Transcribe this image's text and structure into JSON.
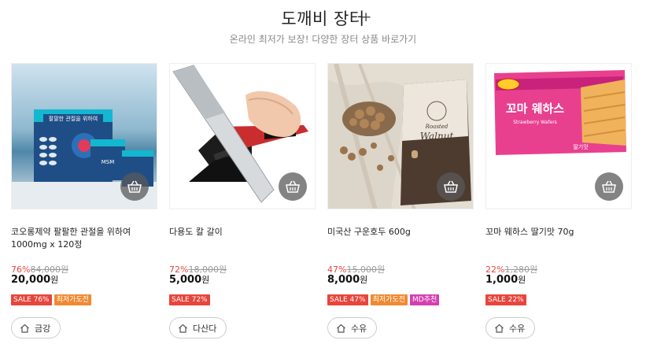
{
  "header": {
    "title": "도깨비 장터",
    "plus": "+",
    "subtitle": "온라인 최저가 보장! 다양한 장터 상품 바로가기"
  },
  "colors": {
    "discount": "#e8453c",
    "sale_badge": "#e8453c",
    "lowest_badge": "#f08a32",
    "md_badge": "#d63fb0"
  },
  "products": [
    {
      "name": "코오롱제약 팔팔한 관절을 위하여 1000mg x 120정",
      "rate": "76%",
      "original_price": "84,000원",
      "price": "20,000",
      "currency": "원",
      "badges": [
        "SALE 76%",
        "최저가도전"
      ],
      "seller": "금강",
      "image_texts": [
        "팔팔한 관절을 위하여",
        "MSM"
      ],
      "icons": [
        "shopping-basket-icon",
        "home-icon"
      ]
    },
    {
      "name": "다용도 칼 갈이",
      "rate": "72%",
      "original_price": "18,000원",
      "price": "5,000",
      "currency": "원",
      "badges": [
        "SALE 72%"
      ],
      "seller": "다산다",
      "icons": [
        "shopping-basket-icon",
        "home-icon"
      ]
    },
    {
      "name": "미국산 구운호두 600g",
      "rate": "47%",
      "original_price": "15,000원",
      "price": "8,000",
      "currency": "원",
      "badges": [
        "SALE 47%",
        "최저가도전",
        "MD추천"
      ],
      "seller": "수유",
      "image_texts": [
        "Roasted",
        "Walnut"
      ],
      "icons": [
        "shopping-basket-icon",
        "home-icon"
      ]
    },
    {
      "name": "꼬마 웨하스 딸기맛 70g",
      "rate": "22%",
      "original_price": "1,280원",
      "price": "1,000",
      "currency": "원",
      "badges": [
        "SALE 22%"
      ],
      "seller": "수유",
      "image_texts": [
        "꼬마 웨하스",
        "Strawberry Wafers",
        "딸기맛"
      ],
      "icons": [
        "shopping-basket-icon",
        "home-icon"
      ]
    }
  ]
}
